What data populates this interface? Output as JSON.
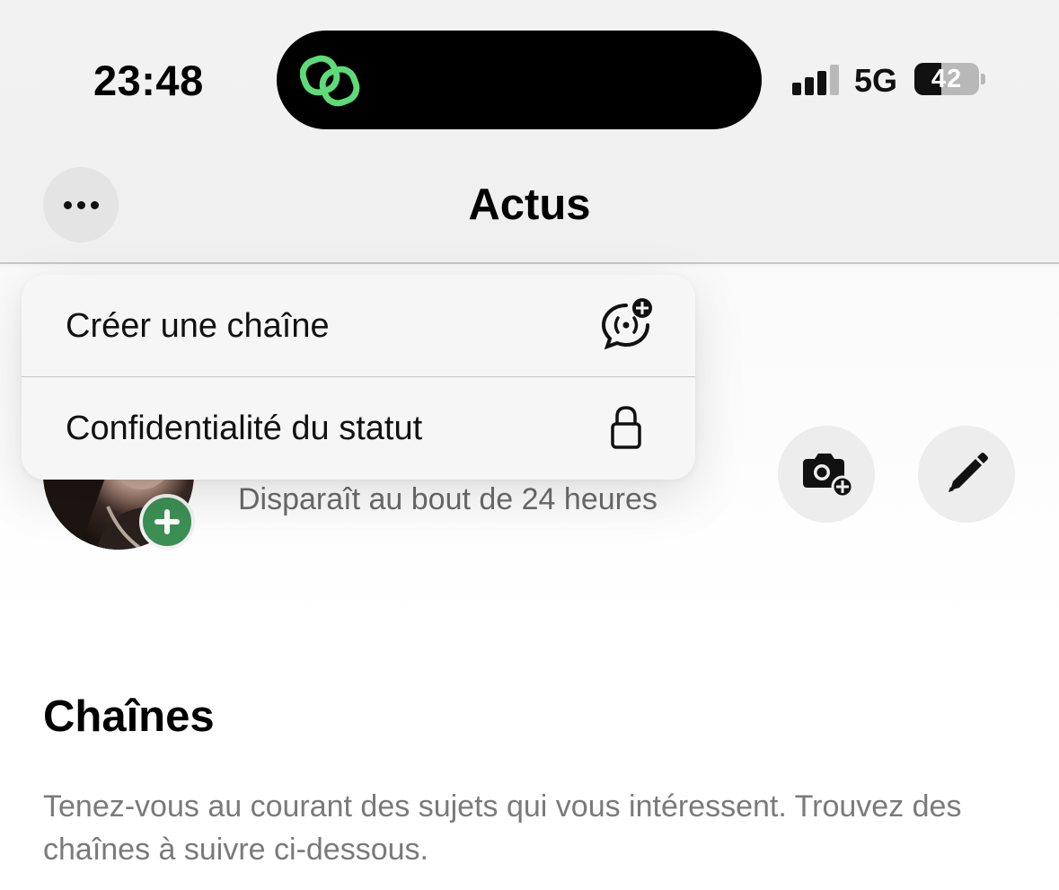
{
  "status_bar": {
    "time": "23:48",
    "network": "5G",
    "battery_level": "42",
    "battery_fraction": 0.42,
    "signal_bars_active": 3,
    "signal_bars_total": 4,
    "island_icon": "link-rings-icon",
    "island_icon_color": "#5ddb78"
  },
  "nav": {
    "title": "Actus",
    "more_icon": "ellipsis-icon"
  },
  "menu": {
    "items": [
      {
        "label": "Créer une chaîne",
        "icon": "channel-add-icon"
      },
      {
        "label": "Confidentialité du statut",
        "icon": "lock-icon"
      }
    ]
  },
  "status_row": {
    "subtitle": "Disparaît au bout de 24 heures",
    "add_badge_color": "#3c9054",
    "camera_icon": "camera-add-icon",
    "edit_icon": "pencil-icon"
  },
  "channels": {
    "title": "Chaînes",
    "description": "Tenez-vous au courant des sujets qui vous intéressent. Trouvez des chaînes à suivre ci-dessous."
  }
}
